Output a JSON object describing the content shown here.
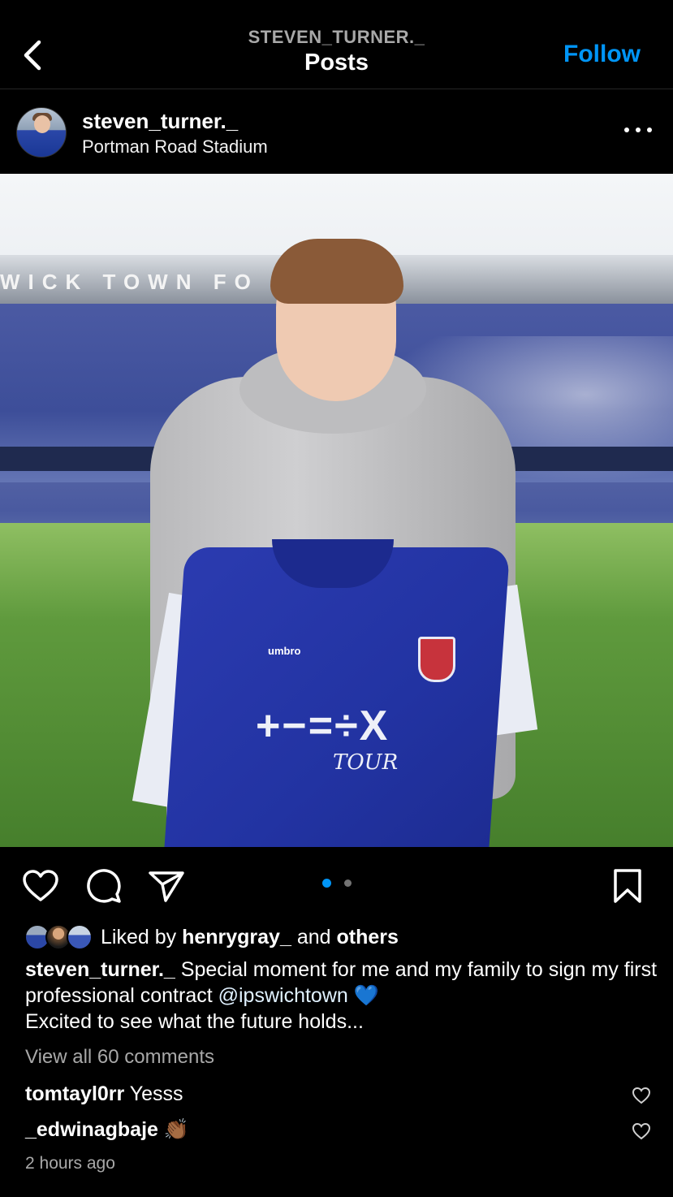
{
  "header": {
    "handle": "STEVEN_TURNER._",
    "title": "Posts",
    "follow_label": "Follow"
  },
  "post": {
    "username": "steven_turner._",
    "location": "Portman Road Stadium",
    "photo": {
      "roof_text": "WICK TOWN FO CLUB",
      "shirt_brand": "umbro",
      "shirt_sponsor": "+−=÷X",
      "shirt_sponsor_sub": "TOUR"
    },
    "carousel": {
      "total": 2,
      "active": 1
    },
    "likes": {
      "prefix": "Liked by",
      "user": "henrygray_",
      "conj": "and",
      "others": "others"
    },
    "caption": {
      "username": "steven_turner._",
      "text_1": " Special moment for me and my family to sign my first professional contract ",
      "mention": "@ipswichtown",
      "emoji": "💙",
      "text_2": "Excited to see what the future holds..."
    },
    "view_all": "View all 60 comments",
    "comments": [
      {
        "user": "tomtayl0rr",
        "text": "Yesss"
      },
      {
        "user": "_edwinagbaje",
        "text": "👏🏾"
      }
    ],
    "timestamp": "2 hours ago"
  },
  "icons": {
    "back": "chevron-left-icon",
    "more": "more-horizontal-icon",
    "like": "heart-icon",
    "comment": "comment-icon",
    "share": "send-icon",
    "save": "bookmark-icon"
  },
  "colors": {
    "accent": "#0095f6",
    "background": "#000000",
    "secondary_text": "#a8a8a8"
  }
}
